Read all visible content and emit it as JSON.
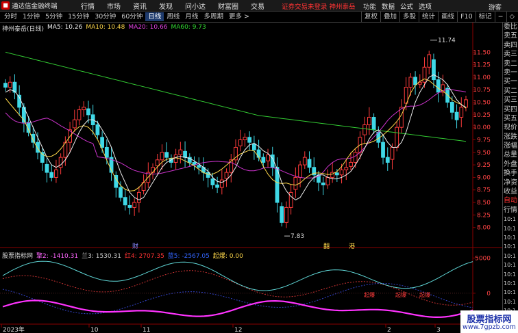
{
  "app": {
    "name": "通达信金融终端",
    "menu": [
      "行情",
      "市场",
      "资讯",
      "发现",
      "问小达",
      "财富圈",
      "交易"
    ],
    "notice": "证券交易未登录  神州泰岳",
    "right_menu": [
      "功能",
      "数据",
      "公式",
      "选项"
    ],
    "guest": "游客"
  },
  "toolbar": {
    "periods": [
      "分时",
      "1分钟",
      "5分钟",
      "15分钟",
      "30分钟",
      "60分钟",
      "日线",
      "周线",
      "月线",
      "多周期",
      "更多 >"
    ],
    "active_period": "日线",
    "tools": [
      "复权",
      "叠加",
      "多股",
      "统计",
      "画线",
      "F10",
      "标记",
      "−",
      "◇"
    ]
  },
  "main_legend": {
    "stock": "神州泰岳(日线)",
    "ma5": "MA5: 10.26",
    "ma10": "MA10: 10.48",
    "ma20": "MA20: 10.66",
    "ma60": "MA60: 9.73"
  },
  "sub_legend": {
    "name": "股票指标网",
    "v1": "擎2: -1410.31",
    "v2": "兰3: 1530.31",
    "v3": "红4: 2707.35",
    "v4": "蓝5: -2567.05",
    "v5": "起爆: 0.00"
  },
  "chart_data": {
    "type": "candlestick",
    "price_ticks": [
      "11.50",
      "11.25",
      "11.00",
      "10.75",
      "10.50",
      "10.25",
      "10.00",
      "9.75",
      "9.50",
      "9.25",
      "9.00",
      "8.75",
      "8.50",
      "8.25",
      "8.00"
    ],
    "ylim": [
      7.75,
      11.9
    ],
    "indicator_ticks": [
      "5000",
      "0"
    ],
    "indicator_ylim": [
      -4000,
      6000
    ],
    "x_ticks": [
      "2023年",
      "10",
      "11",
      "12",
      "2",
      "3"
    ],
    "high_label": "11.74",
    "low_label": "7.83",
    "events": [
      "财",
      "翻",
      "港"
    ],
    "indicator_tags": [
      "起爆",
      "起爆",
      "起爆"
    ],
    "closes": [
      10.8,
      10.9,
      10.7,
      10.4,
      10.1,
      9.9,
      9.7,
      9.5,
      9.3,
      9.1,
      9.0,
      9.15,
      9.4,
      9.7,
      9.95,
      10.15,
      10.35,
      10.4,
      10.25,
      10.05,
      9.85,
      9.6,
      9.4,
      9.1,
      8.8,
      8.6,
      8.45,
      8.4,
      8.5,
      8.7,
      8.9,
      9.1,
      9.2,
      9.35,
      9.5,
      9.4,
      9.3,
      9.45,
      9.55,
      9.4,
      9.3,
      9.25,
      9.2,
      9.1,
      9.0,
      8.85,
      8.8,
      8.95,
      9.1,
      9.35,
      9.6,
      9.75,
      9.8,
      9.7,
      9.55,
      9.4,
      9.3,
      9.45,
      9.2,
      8.5,
      8.1,
      8.4,
      8.7,
      9.0,
      9.25,
      9.4,
      9.2,
      9.05,
      8.9,
      8.85,
      9.0,
      9.1,
      9.05,
      9.15,
      9.2,
      9.3,
      9.5,
      9.8,
      10.05,
      10.2,
      9.95,
      9.7,
      9.4,
      9.3,
      9.6,
      10.0,
      10.4,
      10.8,
      11.0,
      10.85,
      10.9,
      11.2,
      11.45,
      10.95,
      10.7,
      10.85,
      10.5,
      10.3,
      10.15,
      10.4,
      10.55
    ],
    "ma5": [
      10.7,
      10.75,
      10.72,
      10.6,
      10.4,
      10.2,
      10.0,
      9.8,
      9.6,
      9.4,
      9.25,
      9.2,
      9.25,
      9.35,
      9.5,
      9.7,
      9.9,
      10.05,
      10.15,
      10.15,
      10.1,
      9.95,
      9.8,
      9.6,
      9.35,
      9.1,
      8.9,
      8.7,
      8.6,
      8.55,
      8.6,
      8.75,
      8.9,
      9.05,
      9.2,
      9.3,
      9.35,
      9.4,
      9.42,
      9.4,
      9.38,
      9.33,
      9.27,
      9.2,
      9.12,
      9.0,
      8.92,
      8.9,
      8.95,
      9.05,
      9.2,
      9.4,
      9.55,
      9.65,
      9.68,
      9.62,
      9.53,
      9.48,
      9.38,
      9.17,
      8.9,
      8.73,
      8.62,
      8.55,
      8.6,
      8.75,
      8.9,
      9.0,
      9.05,
      9.05,
      9.0,
      8.97,
      8.97,
      9.0,
      9.05,
      9.12,
      9.25,
      9.4,
      9.58,
      9.77,
      9.9,
      9.95,
      9.85,
      9.7,
      9.6,
      9.6,
      9.7,
      9.9,
      10.2,
      10.5,
      10.7,
      10.85,
      11.0,
      11.05,
      11.0,
      10.95,
      10.85,
      10.7,
      10.55,
      10.45,
      10.4
    ]
  },
  "side_panel": [
    "委比",
    "卖五",
    "卖四",
    "卖三",
    "卖二",
    "卖一",
    "买一",
    "买二",
    "买三",
    "买四",
    "买五",
    "现价",
    "涨跌",
    "涨幅",
    "总量",
    "外盘",
    "换手",
    "净资",
    "收益",
    "自动",
    "行情",
    "10:1",
    "10:1",
    "10:1",
    "10:1",
    "10:1",
    "10:1",
    "10:1",
    "10:1",
    "10:1",
    "10:1",
    "10:1"
  ],
  "watermark": {
    "title": "股票指标网",
    "url": "www.7gpzb.com"
  }
}
